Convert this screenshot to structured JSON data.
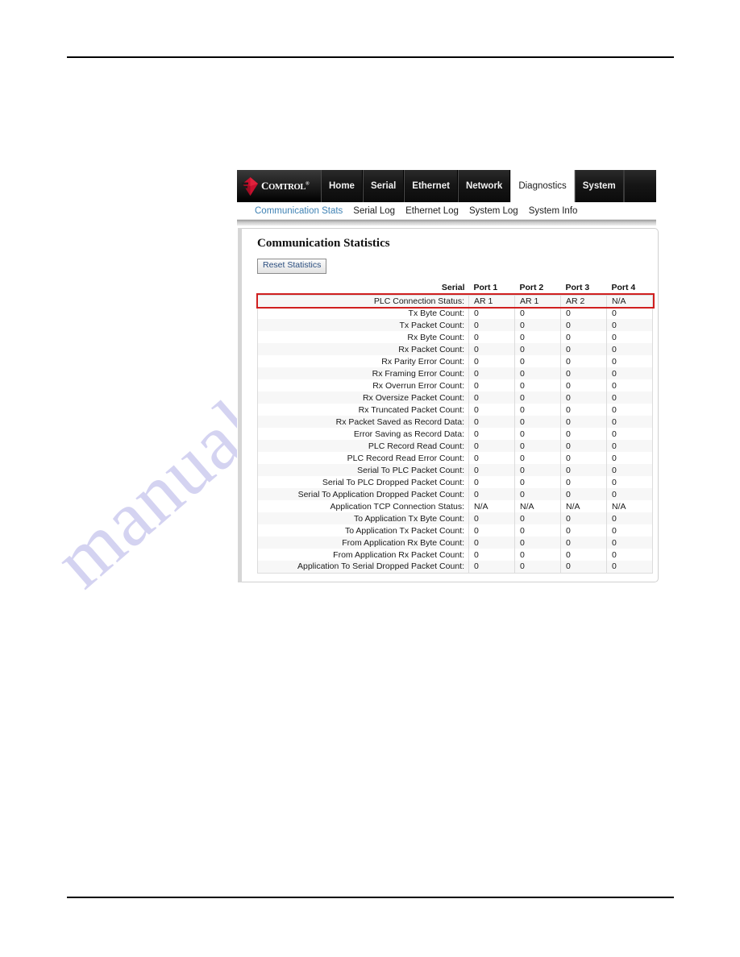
{
  "document": {
    "watermark": "manualslib.com"
  },
  "browser": {
    "brand": {
      "name": "COMTROL",
      "name_caps_lead": "C",
      "name_rest": "OMTROL",
      "registered_mark": "®",
      "logo_color": "#c8102e"
    },
    "nav": {
      "tabs": [
        {
          "label": "Home",
          "active": false
        },
        {
          "label": "Serial",
          "active": false
        },
        {
          "label": "Ethernet",
          "active": false
        },
        {
          "label": "Network",
          "active": false
        },
        {
          "label": "Diagnostics",
          "active": true
        },
        {
          "label": "System",
          "active": false
        }
      ]
    },
    "subnav": {
      "items": [
        {
          "label": "Communication Stats",
          "active": true
        },
        {
          "label": "Serial Log",
          "active": false
        },
        {
          "label": "Ethernet Log",
          "active": false
        },
        {
          "label": "System Log",
          "active": false
        },
        {
          "label": "System Info",
          "active": false
        }
      ],
      "active_color": "#3f82b4"
    },
    "panel": {
      "title": "Communication Statistics",
      "reset_button_label": "Reset Statistics",
      "highlight_color": "#d01f1f"
    },
    "table": {
      "columns": [
        "Serial",
        "Port 1",
        "Port 2",
        "Port 3",
        "Port 4"
      ],
      "label_column_header": "Serial",
      "rows": [
        {
          "label": "PLC Connection Status:",
          "values": [
            "AR 1",
            "AR 1",
            "AR 2",
            "N/A"
          ],
          "highlighted": true
        },
        {
          "label": "Tx Byte Count:",
          "values": [
            "0",
            "0",
            "0",
            "0"
          ],
          "highlighted": false
        },
        {
          "label": "Tx Packet Count:",
          "values": [
            "0",
            "0",
            "0",
            "0"
          ],
          "highlighted": false
        },
        {
          "label": "Rx Byte Count:",
          "values": [
            "0",
            "0",
            "0",
            "0"
          ],
          "highlighted": false
        },
        {
          "label": "Rx Packet Count:",
          "values": [
            "0",
            "0",
            "0",
            "0"
          ],
          "highlighted": false
        },
        {
          "label": "Rx Parity Error Count:",
          "values": [
            "0",
            "0",
            "0",
            "0"
          ],
          "highlighted": false
        },
        {
          "label": "Rx Framing Error Count:",
          "values": [
            "0",
            "0",
            "0",
            "0"
          ],
          "highlighted": false
        },
        {
          "label": "Rx Overrun Error Count:",
          "values": [
            "0",
            "0",
            "0",
            "0"
          ],
          "highlighted": false
        },
        {
          "label": "Rx Oversize Packet Count:",
          "values": [
            "0",
            "0",
            "0",
            "0"
          ],
          "highlighted": false
        },
        {
          "label": "Rx Truncated Packet Count:",
          "values": [
            "0",
            "0",
            "0",
            "0"
          ],
          "highlighted": false
        },
        {
          "label": "Rx Packet Saved as Record Data:",
          "values": [
            "0",
            "0",
            "0",
            "0"
          ],
          "highlighted": false
        },
        {
          "label": "Error Saving as Record Data:",
          "values": [
            "0",
            "0",
            "0",
            "0"
          ],
          "highlighted": false
        },
        {
          "label": "PLC Record Read Count:",
          "values": [
            "0",
            "0",
            "0",
            "0"
          ],
          "highlighted": false
        },
        {
          "label": "PLC Record Read Error Count:",
          "values": [
            "0",
            "0",
            "0",
            "0"
          ],
          "highlighted": false
        },
        {
          "label": "Serial To PLC Packet Count:",
          "values": [
            "0",
            "0",
            "0",
            "0"
          ],
          "highlighted": false
        },
        {
          "label": "Serial To PLC Dropped Packet Count:",
          "values": [
            "0",
            "0",
            "0",
            "0"
          ],
          "highlighted": false
        },
        {
          "label": "Serial To Application Dropped Packet Count:",
          "values": [
            "0",
            "0",
            "0",
            "0"
          ],
          "highlighted": false
        },
        {
          "label": "Application TCP Connection Status:",
          "values": [
            "N/A",
            "N/A",
            "N/A",
            "N/A"
          ],
          "highlighted": false
        },
        {
          "label": "To Application Tx Byte Count:",
          "values": [
            "0",
            "0",
            "0",
            "0"
          ],
          "highlighted": false
        },
        {
          "label": "To Application Tx Packet Count:",
          "values": [
            "0",
            "0",
            "0",
            "0"
          ],
          "highlighted": false
        },
        {
          "label": "From Application Rx Byte Count:",
          "values": [
            "0",
            "0",
            "0",
            "0"
          ],
          "highlighted": false
        },
        {
          "label": "From Application Rx Packet Count:",
          "values": [
            "0",
            "0",
            "0",
            "0"
          ],
          "highlighted": false
        },
        {
          "label": "Application To Serial Dropped Packet Count:",
          "values": [
            "0",
            "0",
            "0",
            "0"
          ],
          "highlighted": false
        }
      ]
    }
  }
}
